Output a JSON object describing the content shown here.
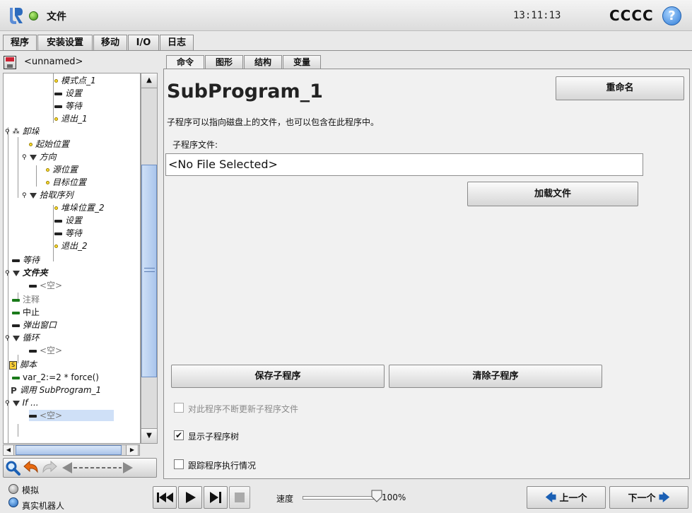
{
  "title_bar": {
    "file_label": "文件",
    "clock": "13:11:13",
    "robot_name": "CCCC",
    "help_icon": "?"
  },
  "main_tabs": [
    {
      "label": "程序",
      "active": true
    },
    {
      "label": "安装设置",
      "active": false
    },
    {
      "label": "移动",
      "active": false
    },
    {
      "label": "I/O",
      "active": false
    },
    {
      "label": "日志",
      "active": false
    }
  ],
  "program": {
    "name": "<unnamed>"
  },
  "tree": [
    {
      "label": "模式点_1",
      "icon": "waypoint-icon",
      "italic": true
    },
    {
      "label": "设置",
      "icon": "command-icon",
      "italic": true
    },
    {
      "label": "等待",
      "icon": "command-icon",
      "italic": true
    },
    {
      "label": "退出_1",
      "icon": "waypoint-icon",
      "italic": true
    },
    {
      "label": "卸垛",
      "icon": "pallet-icon",
      "italic": true
    },
    {
      "label": "起始位置",
      "icon": "waypoint-icon",
      "italic": true
    },
    {
      "label": "方向",
      "icon": "folder-icon",
      "italic": true
    },
    {
      "label": "源位置",
      "icon": "waypoint-icon",
      "italic": true
    },
    {
      "label": "目标位置",
      "icon": "waypoint-icon",
      "italic": true
    },
    {
      "label": "拾取序列",
      "icon": "folder-icon",
      "italic": true
    },
    {
      "label": "堆垛位置_2",
      "icon": "waypoint-icon",
      "italic": true
    },
    {
      "label": "设置",
      "icon": "command-icon",
      "italic": true
    },
    {
      "label": "等待",
      "icon": "command-icon",
      "italic": true
    },
    {
      "label": "退出_2",
      "icon": "waypoint-icon",
      "italic": true
    },
    {
      "label": "等待",
      "icon": "command-icon",
      "italic": true
    },
    {
      "label": "文件夹",
      "icon": "folder-icon",
      "italic": true
    },
    {
      "label": "<空>",
      "icon": "command-icon",
      "italic": false
    },
    {
      "label": "注释",
      "icon": "command-icon",
      "italic": false
    },
    {
      "label": "中止",
      "icon": "command-icon",
      "italic": false
    },
    {
      "label": "弹出窗口",
      "icon": "command-icon",
      "italic": true
    },
    {
      "label": "循环",
      "icon": "folder-icon",
      "italic": true
    },
    {
      "label": "<空>",
      "icon": "command-icon",
      "italic": false
    },
    {
      "label": "脚本",
      "icon": "script-icon",
      "italic": true
    },
    {
      "label": "var_2:=2 * force()",
      "icon": "command-icon",
      "italic": false
    },
    {
      "label": "调用 SubProgram_1",
      "icon": "call-icon",
      "italic": true
    },
    {
      "label": "If ...",
      "icon": "folder-icon",
      "italic": true
    },
    {
      "label": "<空>",
      "icon": "command-icon",
      "italic": false
    }
  ],
  "sub_tabs": [
    {
      "label": "命令",
      "active": true
    },
    {
      "label": "图形",
      "active": false
    },
    {
      "label": "结构",
      "active": false
    },
    {
      "label": "变量",
      "active": false
    }
  ],
  "content": {
    "title": "SubProgram_1",
    "rename_label": "重命名",
    "description": "子程序可以指向磁盘上的文件，也可以包含在此程序中。",
    "file_label": "子程序文件:",
    "file_value": "<No File Selected>",
    "load_label": "加载文件",
    "save_label": "保存子程序",
    "clear_label": "清除子程序",
    "keep_updated_label": "对此程序不断更新子程序文件",
    "keep_updated_checked": false,
    "show_tree_label": "显示子程序树",
    "show_tree_checked": true,
    "track_label": "跟踪程序执行情况",
    "track_checked": false
  },
  "bottom": {
    "sim_label": "模拟",
    "real_label": "真实机器人",
    "speed_label": "速度",
    "speed_value": "100%",
    "speed_fraction": 1.0,
    "prev_label": "上一个",
    "next_label": "下一个"
  },
  "colors": {
    "accent": "#1a5fb4",
    "status_green": "#3c8f12",
    "waypoint_yellow": "#ffdd33"
  }
}
